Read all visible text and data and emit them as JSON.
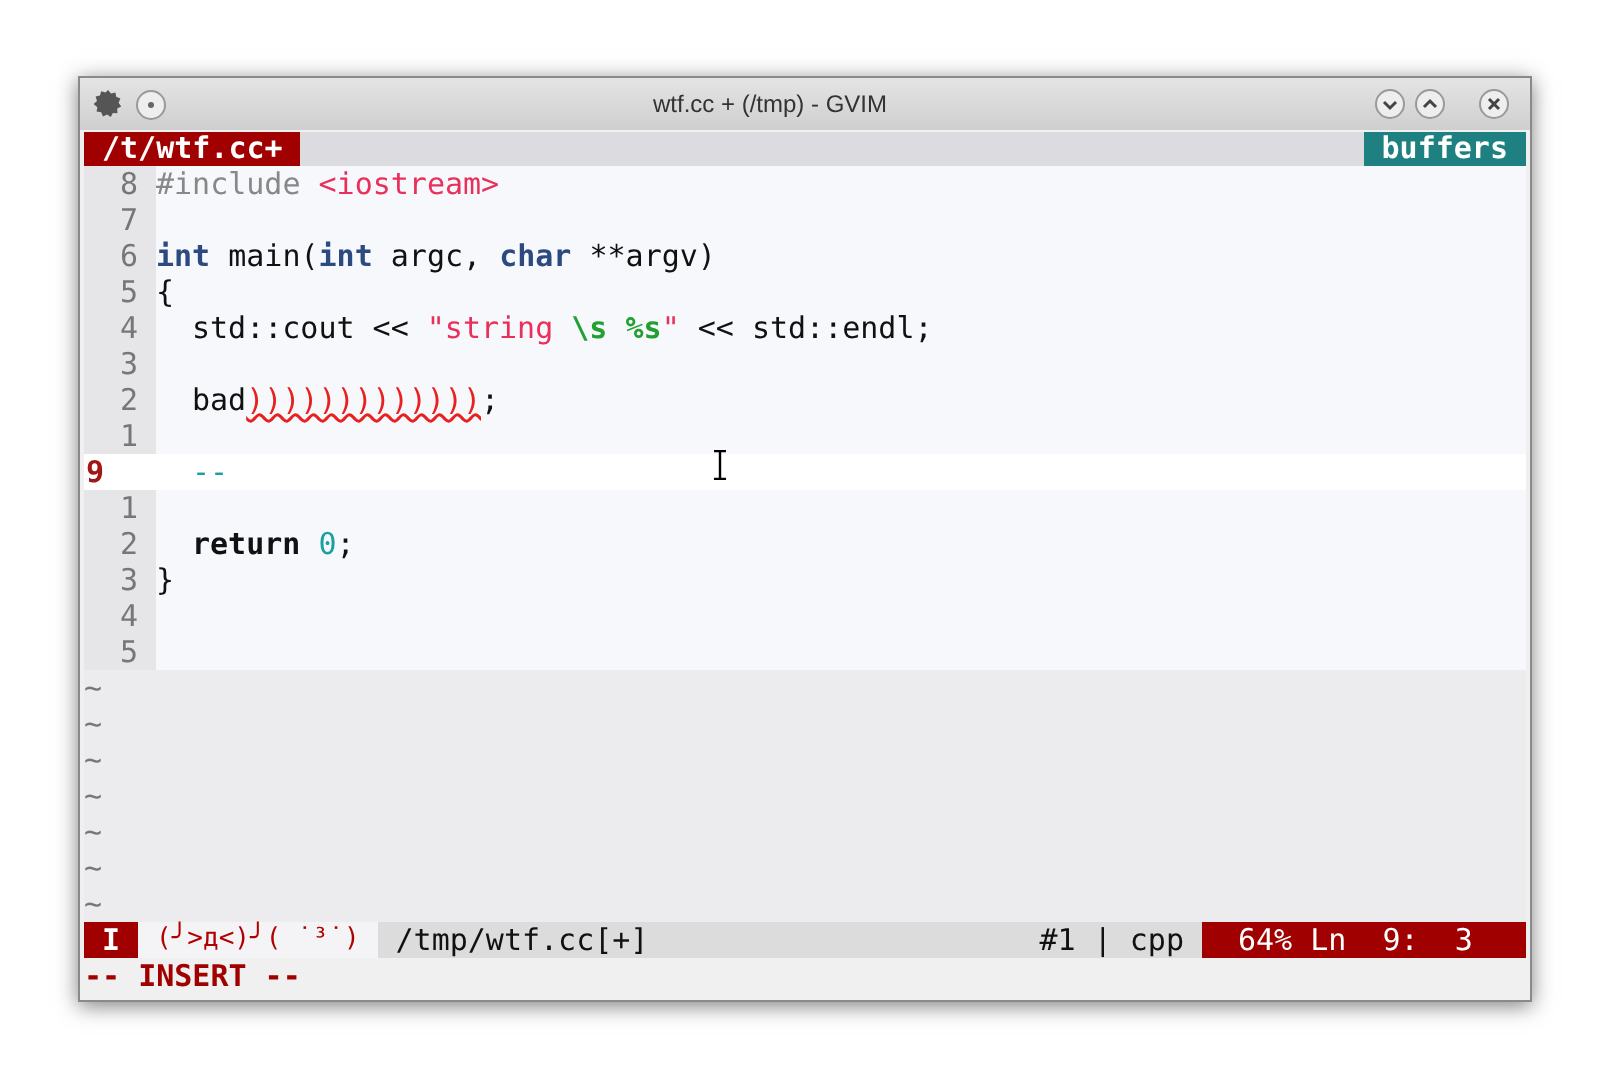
{
  "window": {
    "title": "wtf.cc + (/tmp) - GVIM"
  },
  "tabline": {
    "tabs": [
      {
        "label": "/t/wtf.cc+",
        "selected": true
      }
    ],
    "right_label": "buffers"
  },
  "editor": {
    "lines": [
      {
        "number": "8",
        "current": false,
        "tokens": [
          {
            "kind": "preproc",
            "text": "#include "
          },
          {
            "kind": "string",
            "text": "<iostream>"
          }
        ]
      },
      {
        "number": "7",
        "current": false
      },
      {
        "number": "6",
        "current": false,
        "tokens": [
          {
            "kind": "type",
            "text": "int"
          },
          {
            "kind": "plain",
            "text": " main("
          },
          {
            "kind": "type",
            "text": "int"
          },
          {
            "kind": "plain",
            "text": " argc, "
          },
          {
            "kind": "type",
            "text": "char"
          },
          {
            "kind": "plain",
            "text": " **argv)"
          }
        ]
      },
      {
        "number": "5",
        "current": false,
        "tokens": [
          {
            "kind": "plain",
            "text": "{"
          }
        ]
      },
      {
        "number": "4",
        "current": false,
        "indent": true,
        "tokens": [
          {
            "kind": "plain",
            "text": "std::cout << "
          },
          {
            "kind": "string",
            "text": "\"string "
          },
          {
            "kind": "special",
            "text": "\\s "
          },
          {
            "kind": "special",
            "text": "%s"
          },
          {
            "kind": "string",
            "text": "\""
          },
          {
            "kind": "plain",
            "text": " << std::endl;"
          }
        ]
      },
      {
        "number": "3",
        "current": false
      },
      {
        "number": "2",
        "current": false,
        "indent": true,
        "tokens": [
          {
            "kind": "plain",
            "text": "bad"
          },
          {
            "kind": "error",
            "text": ")))))))))))))"
          },
          {
            "kind": "plain",
            "text": ";"
          }
        ]
      },
      {
        "number": "1",
        "current": false
      },
      {
        "number": "9",
        "current": true,
        "indent": true,
        "tokens": [
          {
            "kind": "comment",
            "text": "--"
          }
        ]
      },
      {
        "number": "1",
        "current": false
      },
      {
        "number": "2",
        "current": false,
        "indent": true,
        "tokens": [
          {
            "kind": "statement",
            "text": "return "
          },
          {
            "kind": "number",
            "text": "0"
          },
          {
            "kind": "plain",
            "text": ";"
          }
        ]
      },
      {
        "number": "3",
        "current": false,
        "tokens": [
          {
            "kind": "plain",
            "text": "}"
          }
        ]
      },
      {
        "number": "4",
        "current": false
      },
      {
        "number": "5",
        "current": false
      }
    ],
    "tildes": [
      "~",
      "~",
      "~",
      "~",
      "~",
      "~",
      "~"
    ]
  },
  "status_line": {
    "mode": "I",
    "face": "(╯>д<)╯( ˙³˙)",
    "file": "/tmp/wtf.cc[+]",
    "buffer_type": "#1 | cpp",
    "position": "64% Ln  9:  3"
  },
  "command_line": "-- INSERT --"
}
